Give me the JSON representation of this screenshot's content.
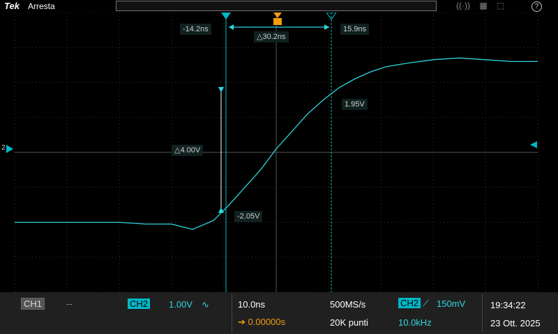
{
  "header": {
    "brand": "Tek",
    "status": "Arresta"
  },
  "cursors": {
    "t1": "-14.2ns",
    "t2": "15.9ns",
    "dt": "△30.2ns",
    "v1": "-2.05V",
    "v2": "1.95V",
    "dv": "△4.00V"
  },
  "markers": {
    "channel": "2"
  },
  "bottom": {
    "ch1": "CH1",
    "ch1_dash": "--",
    "ch2": "CH2",
    "ch2_scale": "1.00V",
    "ch2_coupling": "∿",
    "time_div": "10.0ns",
    "delay": "0.00000s",
    "sample_rate": "500MS/s",
    "record": "20K punti",
    "trig_ch": "CH2",
    "trig_slope": "⟋",
    "trig_level": "150mV",
    "trig_freq": "10.0kHz",
    "time": "19:34:22",
    "date": "23 Ott. 2025"
  },
  "chart_data": {
    "type": "line",
    "x": [
      -50,
      -45,
      -40,
      -30,
      -25,
      -20,
      -16,
      -12,
      -9,
      -6,
      -3,
      0,
      3,
      6,
      9,
      12,
      15,
      18,
      21,
      25,
      30,
      35,
      40,
      45,
      50
    ],
    "series": [
      {
        "values": [
          -2.0,
          -2.0,
          -2.0,
          -2.0,
          -2.05,
          -2.05,
          -2.2,
          -1.95,
          -1.5,
          -1.0,
          -0.5,
          0.1,
          0.6,
          1.1,
          1.5,
          1.85,
          2.1,
          2.3,
          2.45,
          2.55,
          2.65,
          2.7,
          2.65,
          2.6,
          2.6
        ]
      }
    ],
    "xlim": [
      -50,
      50
    ],
    "ylim": [
      -4,
      4
    ]
  }
}
